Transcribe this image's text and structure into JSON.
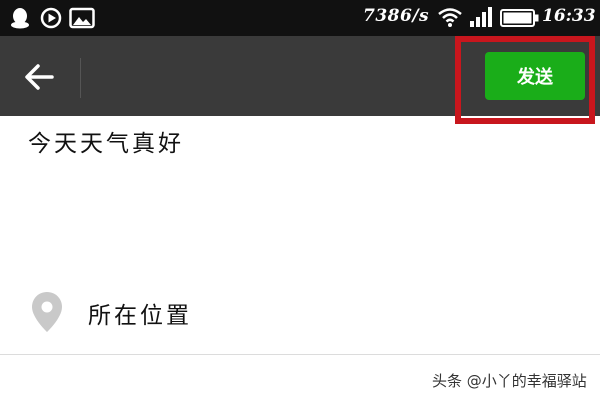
{
  "status_bar": {
    "net_speed": "7386/s",
    "time": "16:33",
    "icons": [
      "qq-icon",
      "play-icon",
      "photo-icon",
      "wifi-icon",
      "signal-icon",
      "battery-icon"
    ]
  },
  "app_bar": {
    "back_icon": "back-arrow-icon",
    "send_label": "发送"
  },
  "content": {
    "text": "今天天气真好",
    "location_label": "所在位置",
    "location_icon": "location-pin-icon"
  },
  "watermark": "头条 @小丫的幸福驿站",
  "colors": {
    "status_bar_bg": "#111111",
    "app_bar_bg": "#3a3a3a",
    "send_button": "#1aad19",
    "highlight_border": "#c8161d"
  }
}
